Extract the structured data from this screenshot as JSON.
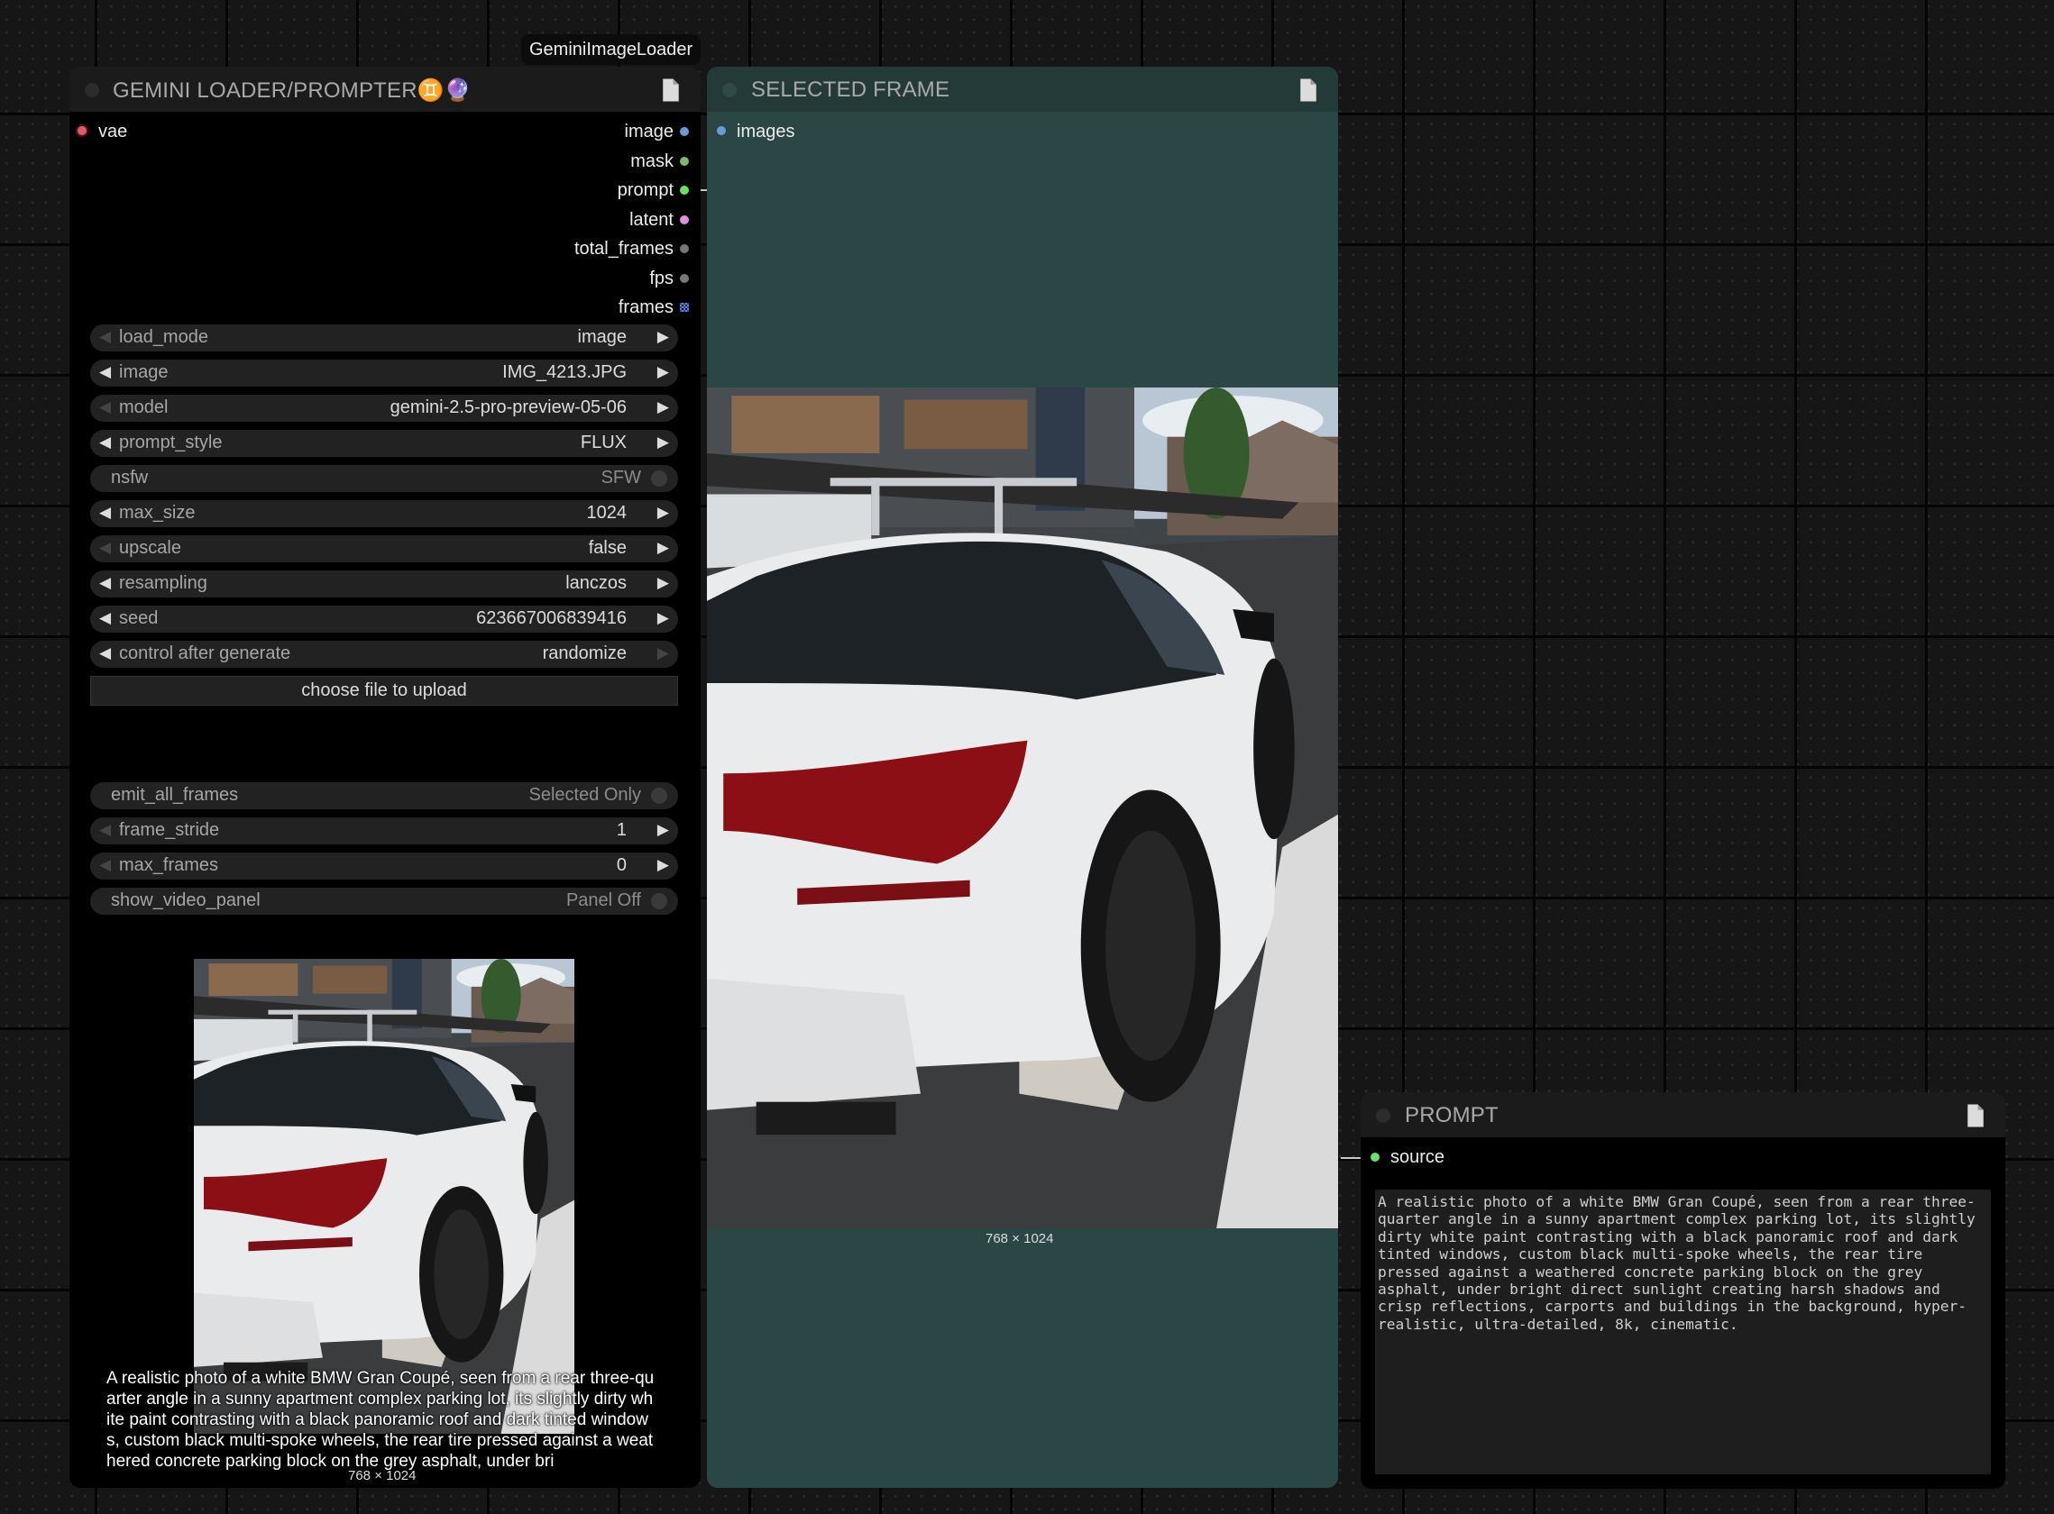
{
  "loader": {
    "title": "GEMINI LOADER/PROMPTER♊🔮",
    "badge": "GeminiImageLoader",
    "inputs": [
      {
        "name": "vae",
        "color": "#e05a68"
      }
    ],
    "outputs": [
      {
        "name": "image",
        "color": "#6c9bd6"
      },
      {
        "name": "mask",
        "color": "#80b86d"
      },
      {
        "name": "prompt",
        "color": "#6be25f"
      },
      {
        "name": "latent",
        "color": "#e28fe0"
      },
      {
        "name": "total_frames",
        "color": "#777777"
      },
      {
        "name": "fps",
        "color": "#777777"
      },
      {
        "name": "frames",
        "color": "#5e84d6"
      }
    ],
    "widgets": [
      {
        "label": "load_mode",
        "value": "image",
        "left_dim": true,
        "right_dim": false
      },
      {
        "label": "image",
        "value": "IMG_4213.JPG",
        "left_dim": false,
        "right_dim": false
      },
      {
        "label": "model",
        "value": "gemini-2.5-pro-preview-05-06",
        "left_dim": true,
        "right_dim": false
      },
      {
        "label": "prompt_style",
        "value": "FLUX",
        "left_dim": false,
        "right_dim": false
      },
      {
        "label": "nsfw",
        "value": "SFW",
        "toggle": true
      },
      {
        "label": "max_size",
        "value": "1024",
        "left_dim": false,
        "right_dim": false
      },
      {
        "label": "upscale",
        "value": "false",
        "left_dim": true,
        "right_dim": false
      },
      {
        "label": "resampling",
        "value": "lanczos",
        "left_dim": false,
        "right_dim": false
      },
      {
        "label": "seed",
        "value": "623667006839416",
        "left_dim": false,
        "right_dim": false
      },
      {
        "label": "control after generate",
        "value": "randomize",
        "left_dim": false,
        "right_dim": true
      }
    ],
    "upload_label": "choose file to upload",
    "video_widgets": [
      {
        "label": "emit_all_frames",
        "value": "Selected Only",
        "toggle": true
      },
      {
        "label": "frame_stride",
        "value": "1",
        "left_dim": true,
        "right_dim": false
      },
      {
        "label": "max_frames",
        "value": "0",
        "left_dim": true,
        "right_dim": false
      },
      {
        "label": "show_video_panel",
        "value": "Panel Off",
        "toggle": true
      }
    ],
    "preview_caption": "768 × 1024",
    "preview_text": "A realistic photo of a white BMW Gran Coupé, seen from a rear three-quarter angle in a sunny apartment complex parking lot, its slightly dirty white paint contrasting with a black panoramic roof and dark tinted windows, custom black multi-spoke wheels, the rear tire pressed against a weathered concrete parking block on the grey asphalt, under bri"
  },
  "selected": {
    "title": "SELECTED FRAME",
    "inputs": [
      {
        "name": "images",
        "color": "#6c9bd6"
      }
    ],
    "caption": "768 × 1024"
  },
  "prompt": {
    "title": "PROMPT",
    "inputs": [
      {
        "name": "source",
        "color": "#6be25f"
      }
    ],
    "text": "A realistic photo of a white BMW Gran Coupé, seen from a rear three-quarter angle in a sunny apartment complex parking lot, its slightly dirty white paint contrasting with a black panoramic roof and dark tinted windows, custom black multi-spoke wheels, the rear tire pressed against a weathered concrete parking block on the grey asphalt, under bright direct sunlight creating harsh shadows and crisp reflections, carports and buildings in the background, hyper-realistic, ultra-detailed, 8k, cinematic."
  },
  "icons": {
    "node_menu": "document-icon",
    "arrow_left": "◀",
    "arrow_right": "▶"
  }
}
